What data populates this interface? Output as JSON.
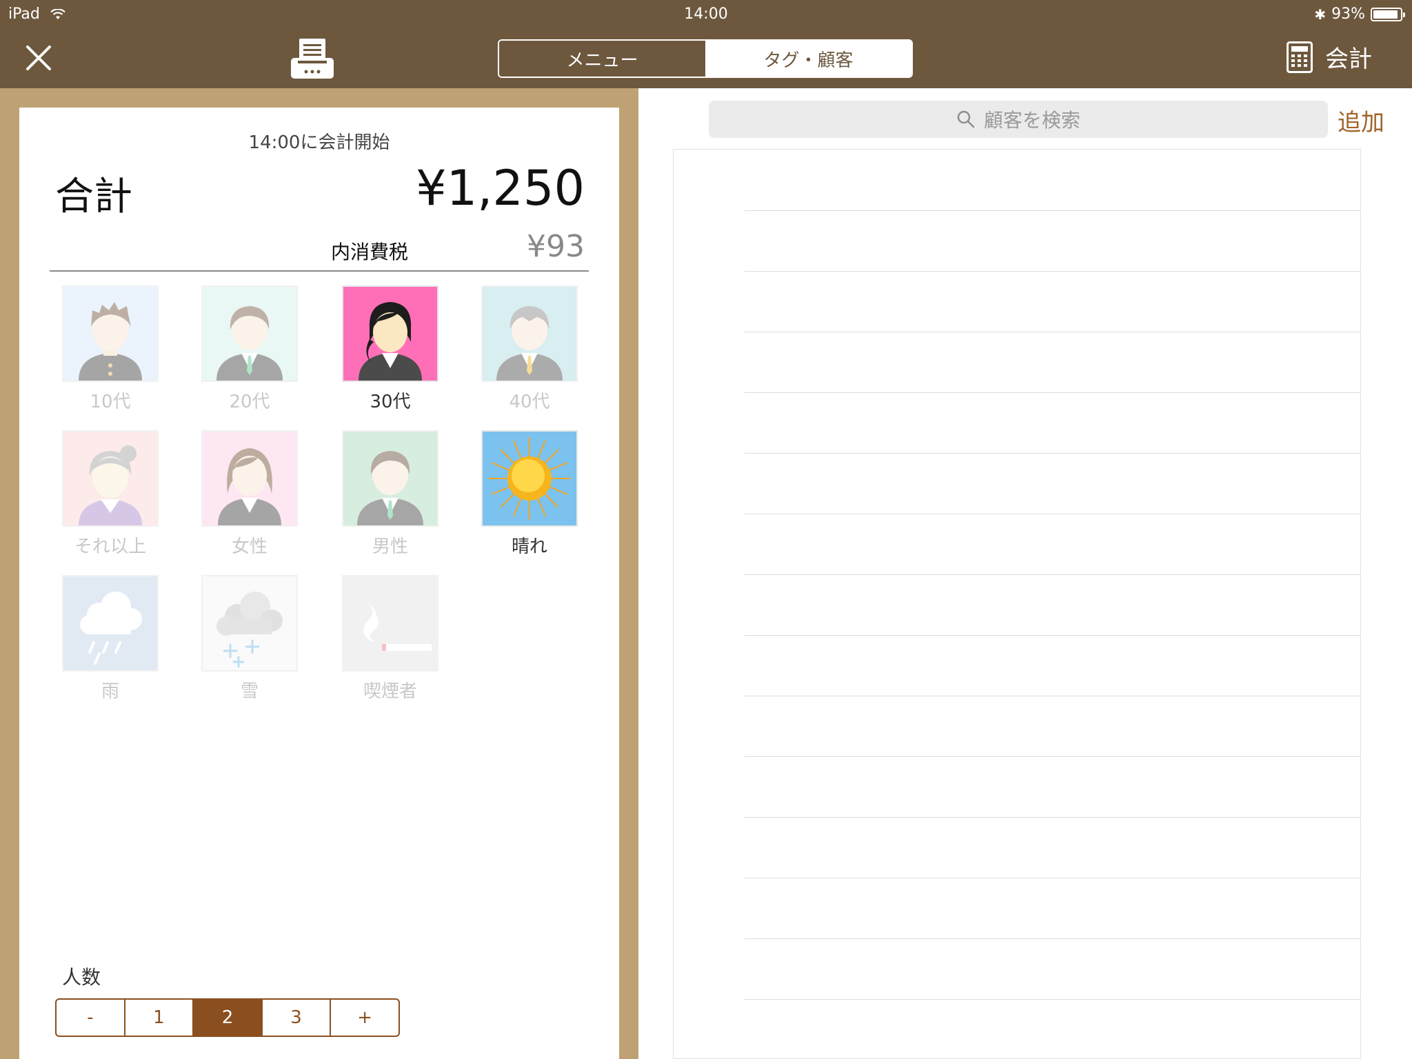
{
  "status_bar": {
    "device": "iPad",
    "time": "14:00",
    "battery": "93%",
    "battery_level": 0.93
  },
  "nav": {
    "tabs": [
      {
        "label": "メニュー",
        "active": false
      },
      {
        "label": "タグ・顧客",
        "active": true
      }
    ],
    "checkout_label": "会計"
  },
  "receipt": {
    "start_time": "14:00に会計開始",
    "total_label": "合計",
    "total_value": "¥1,250",
    "tax_label": "内消費税",
    "tax_value": "¥93"
  },
  "tags": [
    {
      "label": "10代",
      "selected": false,
      "icon": "teen-boy-icon",
      "bg": "#dcecfb"
    },
    {
      "label": "20代",
      "selected": false,
      "icon": "young-man-icon",
      "bg": "#d8f2ee"
    },
    {
      "label": "30代",
      "selected": true,
      "icon": "woman-30s-icon",
      "bg": "#ff6fb8"
    },
    {
      "label": "40代",
      "selected": false,
      "icon": "middle-aged-man-icon",
      "bg": "#b9e1e4"
    },
    {
      "label": "それ以上",
      "selected": false,
      "icon": "elderly-woman-icon",
      "bg": "#fdd9d9"
    },
    {
      "label": "女性",
      "selected": false,
      "icon": "woman-icon",
      "bg": "#fdd5e8"
    },
    {
      "label": "男性",
      "selected": false,
      "icon": "man-icon",
      "bg": "#b7dfc6"
    },
    {
      "label": "晴れ",
      "selected": true,
      "icon": "sunny-icon",
      "bg": "#7cc2ee"
    },
    {
      "label": "雨",
      "selected": false,
      "icon": "rain-icon",
      "bg": "#c9d9e8"
    },
    {
      "label": "雪",
      "selected": false,
      "icon": "snow-icon",
      "bg": "#f7f7f7"
    },
    {
      "label": "喫煙者",
      "selected": false,
      "icon": "smoker-icon",
      "bg": "#e7e7e7"
    }
  ],
  "party": {
    "label": "人数",
    "options": [
      "-",
      "1",
      "2",
      "3",
      "+"
    ],
    "selected": "2"
  },
  "customers": {
    "search_placeholder": "顧客を検索",
    "add_label": "追加"
  },
  "colors": {
    "bar": "#6d583e",
    "panel": "#bfa274",
    "accent": "#8b4f1f",
    "link": "#a0642b"
  }
}
